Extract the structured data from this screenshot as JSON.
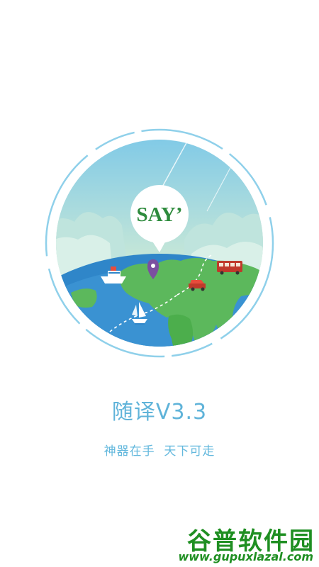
{
  "splash": {
    "logo_text": "SAY’",
    "title": "随译V3.3",
    "tagline": "神器在手  天下可走"
  },
  "watermark": {
    "name": "谷普软件园",
    "url": "www.gupuxlazal.com"
  },
  "colors": {
    "accent": "#5fb3d9",
    "ocean": "#2f86c9",
    "land": "#5cb85c",
    "logo_green": "#2e8b3d",
    "watermark_green": "#1f8f22"
  }
}
